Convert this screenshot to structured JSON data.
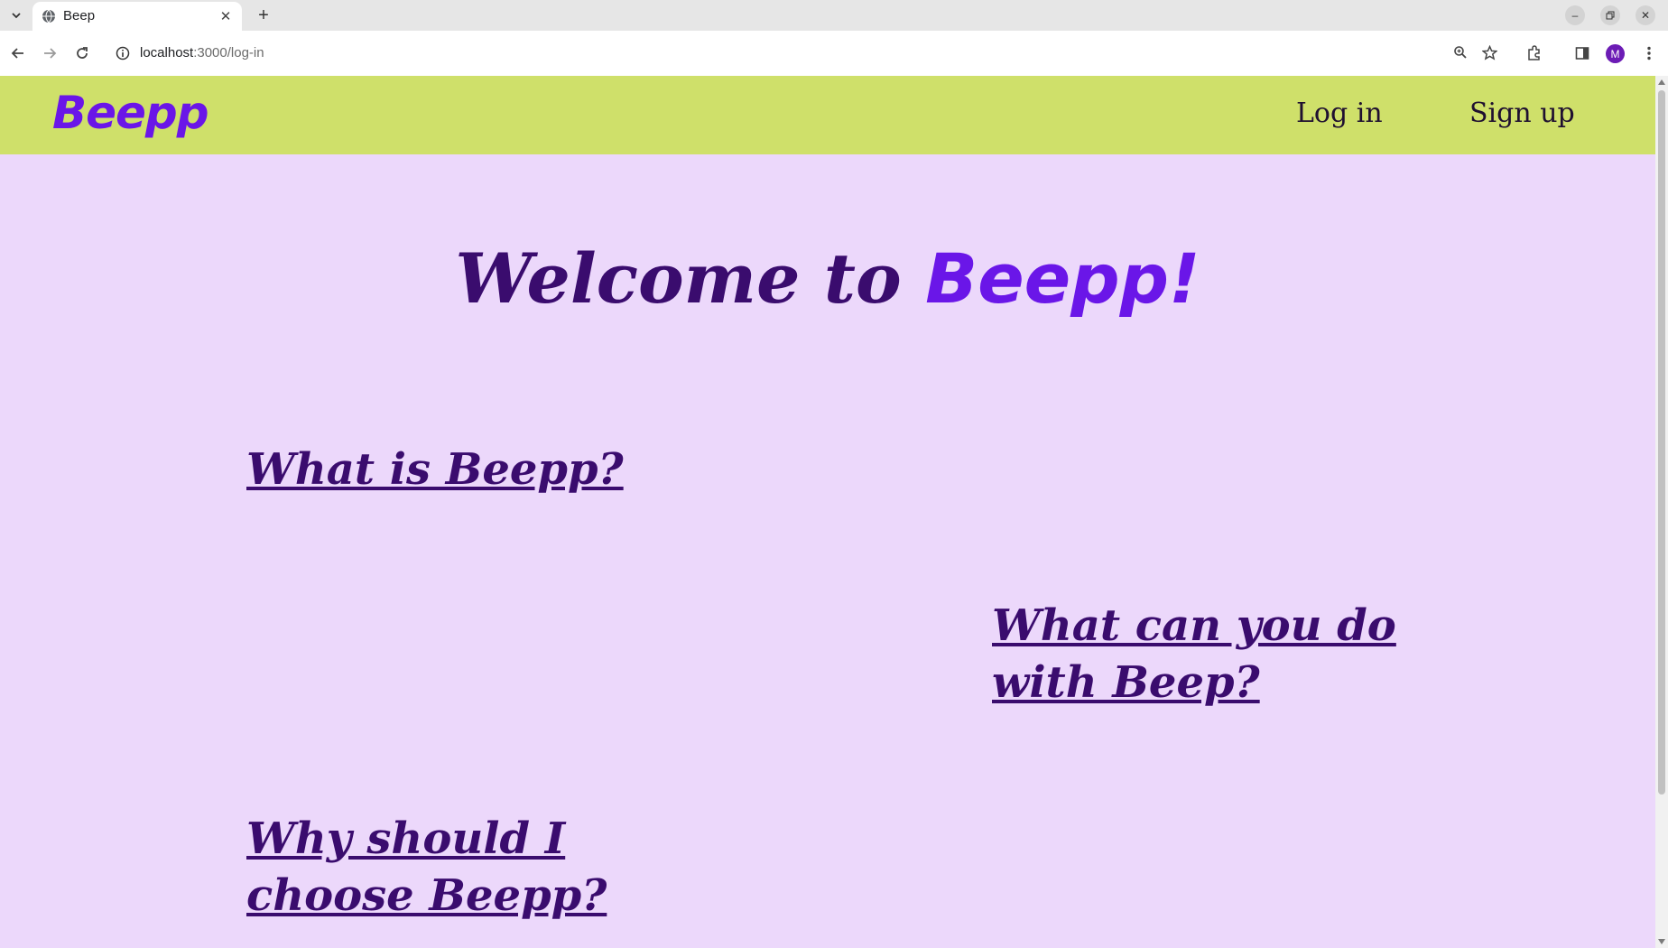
{
  "browser": {
    "tab_title": "Beep",
    "url_host": "localhost",
    "url_path": ":3000/log-in",
    "avatar_letter": "M"
  },
  "site": {
    "logo": "Beepp",
    "nav": {
      "login": "Log in",
      "signup": "Sign up"
    },
    "hero": {
      "prefix": "Welcome to ",
      "brand": "Beepp!"
    },
    "sections": [
      {
        "label": "What is Beepp?"
      },
      {
        "label_line1": "What can you do",
        "label_line2": "with Beep?"
      },
      {
        "label_line1": "Why should I",
        "label_line2": "choose Beepp?"
      }
    ]
  },
  "colors": {
    "header_bg": "#cfe06a",
    "page_bg": "#ecd8fb",
    "brand_purple": "#6a16e8",
    "heading_purple": "#3a0c6e"
  }
}
